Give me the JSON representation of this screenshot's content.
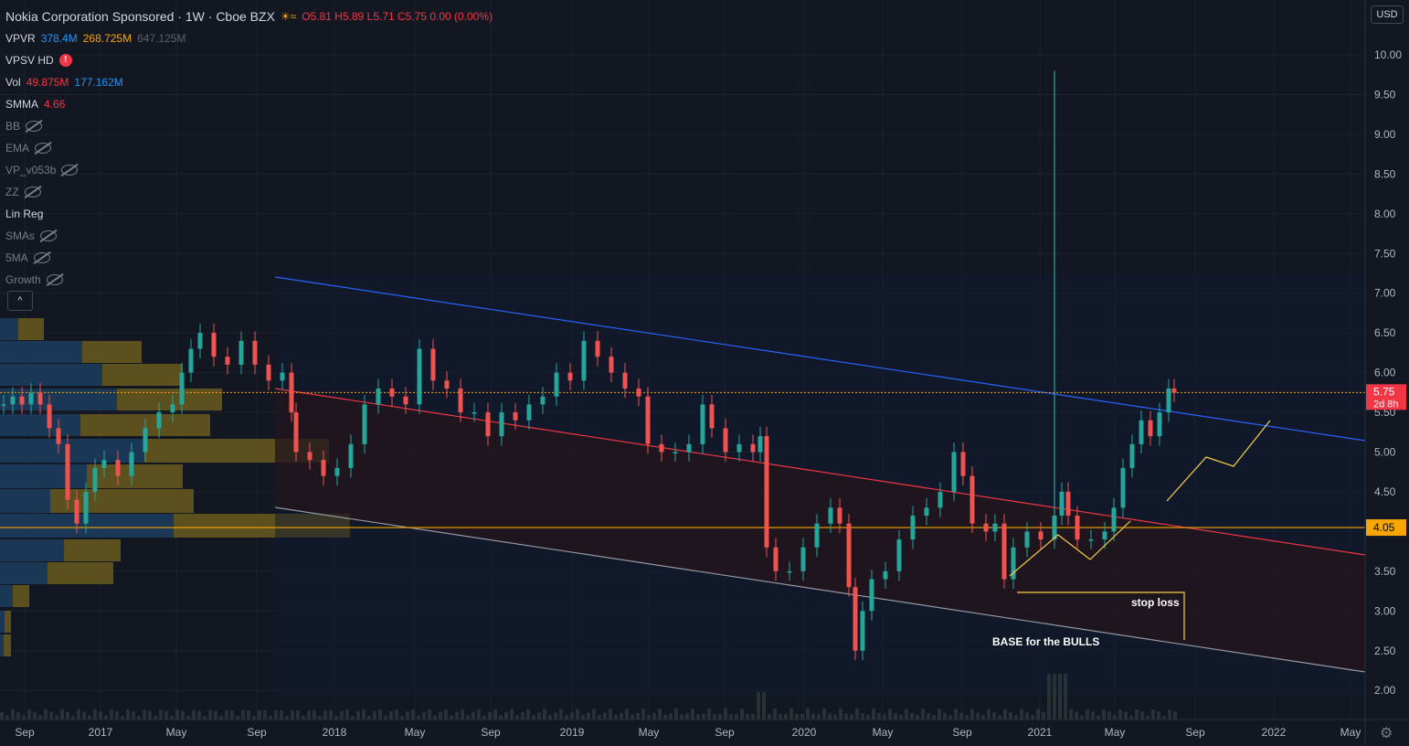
{
  "header": {
    "title": "Nokia Corporation Sponsored · 1W · Cboe BZX",
    "ohlc": "O5.81 H5.89 L5.71 C5.75 0.00 (0.00%)",
    "sun_icon": "sun-icon",
    "currency": "USD"
  },
  "indicators": [
    {
      "name": "VPVR",
      "values": [
        "378.4M",
        "268.725M",
        "647.125M"
      ],
      "colors": [
        "#2196f3",
        "#f7a600",
        "#5d606b"
      ]
    },
    {
      "name": "VPSV HD",
      "warn": "!"
    },
    {
      "name": "Vol",
      "values": [
        "49.875M",
        "177.162M"
      ],
      "colors": [
        "#f23645",
        "#2196f3"
      ]
    },
    {
      "name": "SMMA",
      "values": [
        "4.66"
      ],
      "colors": [
        "#f23645"
      ]
    },
    {
      "name": "BB",
      "hidden": true
    },
    {
      "name": "EMA",
      "hidden": true
    },
    {
      "name": "VP_v053b",
      "hidden": true
    },
    {
      "name": "ZZ",
      "hidden": true
    },
    {
      "name": "Lin Reg"
    },
    {
      "name": "SMAs",
      "hidden": true
    },
    {
      "name": "5MA",
      "hidden": true
    },
    {
      "name": "Growth",
      "hidden": true
    }
  ],
  "collapse_label": "^",
  "chart_data": {
    "type": "candlestick",
    "y_ticks": [
      "10.00",
      "9.50",
      "9.00",
      "8.50",
      "8.00",
      "7.50",
      "7.00",
      "6.50",
      "6.00",
      "5.50",
      "5.00",
      "4.50",
      "4.00",
      "3.50",
      "3.00",
      "2.50",
      "2.00"
    ],
    "y_tick_values": [
      10,
      9.5,
      9,
      8.5,
      8,
      7.5,
      7,
      6.5,
      6,
      5.5,
      5,
      4.5,
      4,
      3.5,
      3,
      2.5,
      2
    ],
    "ylim": [
      1.5,
      10.5
    ],
    "x_ticks": [
      "Sep",
      "2017",
      "May",
      "Sep",
      "2018",
      "May",
      "Sep",
      "2019",
      "May",
      "Sep",
      "2020",
      "May",
      "Sep",
      "2021",
      "May",
      "Sep",
      "2022",
      "May"
    ],
    "last_price": {
      "label": "5.75",
      "sub": "2d 8h",
      "value": 5.75,
      "color": "#f23645"
    },
    "level_line": {
      "label": "4.05",
      "value": 4.05,
      "color": "#f7a600"
    },
    "annotations": [
      "stop loss",
      "BASE for the BULLS"
    ],
    "colors": {
      "up": "#26a69a",
      "down": "#ef5350",
      "channel_top": "#2962ff",
      "channel_mid": "#f23645",
      "channel_bot": "#9598a1",
      "arrow": "#f7d148"
    }
  }
}
